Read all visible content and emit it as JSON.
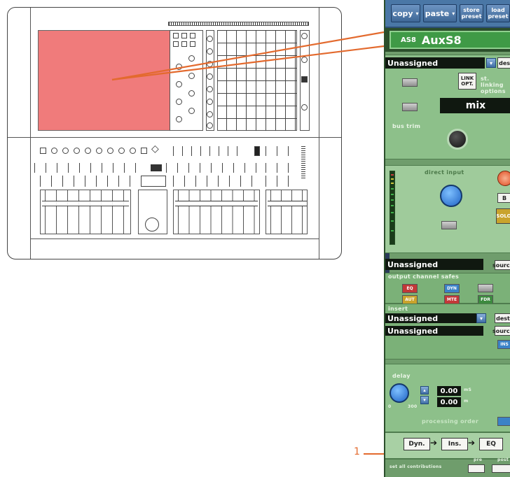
{
  "toolbar": {
    "copy": "copy",
    "paste": "paste",
    "store_preset": [
      "store",
      "preset"
    ],
    "load_preset": [
      "load",
      "preset"
    ],
    "dropdown_glyph": "▾"
  },
  "channel": {
    "code": "AS8",
    "name": "AuxS8"
  },
  "top_section": {
    "routing_dest": "Unassigned",
    "dest_btn": "dest",
    "link_opt": [
      "LINK",
      "OPT."
    ],
    "link_label": [
      "st. linking",
      "options"
    ],
    "mix_label": "mix"
  },
  "bus_trim": {
    "label": "bus trim"
  },
  "direct_input": {
    "label": "direct input",
    "b_btn": "B",
    "solo_btn": "SOLO"
  },
  "source": {
    "field": "Unassigned",
    "btn": "source"
  },
  "safes": {
    "label": "output channel safes",
    "buttons": [
      "EQ",
      "DYN",
      "AUT",
      "MTE",
      "FDR"
    ]
  },
  "insert": {
    "label": "insert",
    "dest_field": "Unassigned",
    "dest_btn": "dest",
    "source_field": "Unassigned",
    "source_btn": "source",
    "ins_btn": "INS"
  },
  "delay": {
    "label": "delay",
    "ms_value": "0.00",
    "ms_unit": "mS",
    "m_value": "0.00",
    "m_unit": "m",
    "knob_min": "0",
    "knob_max": "300"
  },
  "processing_order": {
    "label": "processing order",
    "items": [
      "Dyn.",
      "Ins.",
      "EQ"
    ]
  },
  "contributions": {
    "label": "set all contributions",
    "pre": "pre",
    "post": "post"
  },
  "callout": {
    "number": "1"
  },
  "colors": {
    "accent_orange": "#e36a2e",
    "panel_green": "#8dc08a",
    "screen_red": "#f07b7b"
  }
}
